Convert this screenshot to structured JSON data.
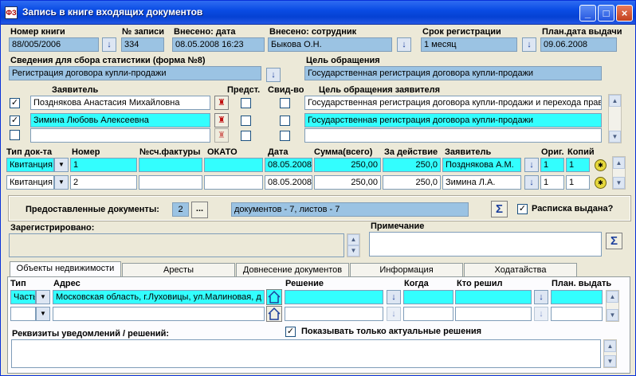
{
  "window": {
    "title": "Запись в книге входящих документов",
    "minimize_glyph": "_",
    "maximize_glyph": "□",
    "close_glyph": "×"
  },
  "header": {
    "book_label": "Номер книги",
    "book_value": "88/005/2006",
    "record_label": "№ записи",
    "record_value": "334",
    "entered_date_label": "Внесено: дата",
    "entered_date_value": "08.05.2008 16:23",
    "entered_by_label": "Внесено: сотрудник",
    "entered_by_value": "Быкова О.Н.",
    "reg_term_label": "Срок регистрации",
    "reg_term_value": "1 месяц",
    "plan_date_label": "План.дата выдачи",
    "plan_date_value": "09.06.2008"
  },
  "stats": {
    "label": "Сведения для сбора статистики (форма №8)",
    "value": "Регистрация договора купли-продажи",
    "purpose_label": "Цель обращения",
    "purpose_value": "Государственная регистрация договора купли-продажи"
  },
  "applicants": {
    "col_applicant": "Заявитель",
    "col_repr": "Предст.",
    "col_cert": "Свид-во",
    "col_purpose": "Цель обращения заявителя",
    "rows": [
      {
        "checked": "✓",
        "name": "Позднякова Анастасия Михайловна",
        "purpose": "Государственная регистрация договора купли-продажи и перехода прав"
      },
      {
        "checked": "✓",
        "name": "Зимина Любовь Алексеевна",
        "purpose": "Государственная регистрация договора купли-продажи"
      },
      {
        "checked": "",
        "name": "",
        "purpose": ""
      }
    ]
  },
  "payments": {
    "col_doc_type": "Тип док-та",
    "col_number": "Номер",
    "col_invoice": "№сч.фактуры",
    "col_okato": "ОКАТО",
    "col_date": "Дата",
    "col_sum": "Сумма(всего)",
    "col_for_action": "За действие",
    "col_applicant": "Заявитель",
    "col_orig": "Ориг.",
    "col_copies": "Копий",
    "rows": [
      {
        "type": "Квитанция",
        "number": "1",
        "invoice": "",
        "okato": "",
        "date": "08.05.2008",
        "sum": "250,00",
        "action": "250,0",
        "applicant": "Позднякова А.М.",
        "orig": "1",
        "copies": "1"
      },
      {
        "type": "Квитанция",
        "number": "2",
        "invoice": "",
        "okato": "",
        "date": "08.05.2008",
        "sum": "250,00",
        "action": "250,0",
        "applicant": "Зимина Л.А.",
        "orig": "1",
        "copies": "1"
      }
    ]
  },
  "provided": {
    "label": "Предоставленные документы:",
    "count": "2",
    "ellipsis": "...",
    "summary": "документов - 7, листов - 7",
    "receipt_label": "Расписка выдана?",
    "receipt_checked": "✓"
  },
  "registered": {
    "label": "Зарегистрировано:",
    "value": ""
  },
  "note": {
    "label": "Примечание",
    "value": ""
  },
  "tabs": [
    {
      "label": "Объекты недвижимости"
    },
    {
      "label": "Аресты"
    },
    {
      "label": "Довнесение документов"
    },
    {
      "label": "Информация"
    },
    {
      "label": "Ходатайства"
    }
  ],
  "objects": {
    "col_type": "Тип",
    "col_address": "Адрес",
    "col_decision": "Решение",
    "col_when": "Когда",
    "col_who": "Кто решил",
    "col_plan": "План. выдать",
    "rows": [
      {
        "type": "Часть",
        "address": "Московская область, г.Луховицы, ул.Малиновая, д",
        "decision": "",
        "when": "",
        "who": "",
        "plan": ""
      },
      {
        "type": "",
        "address": "",
        "decision": "",
        "when": "",
        "who": "",
        "plan": ""
      }
    ],
    "actual_only_label": "Показывать только актуальные решения",
    "actual_only_checked": "✓",
    "notices_label": "Реквизиты уведомлений / решений:",
    "notices_value": ""
  },
  "icons": {
    "dropdown": "↓",
    "combo": "▼",
    "scroll_up": "▲",
    "scroll_down": "▼",
    "sigma": "Σ",
    "person": "♜",
    "coin": "✱"
  },
  "colors": {
    "title_bar": "#0a4ce4",
    "readonly_field": "#9bc3e3",
    "highlight_field": "#33fefe",
    "dialog_bg": "#ece9d8"
  }
}
